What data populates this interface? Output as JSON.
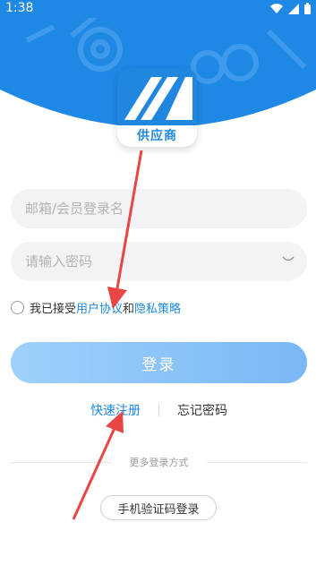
{
  "status_bar": {
    "time": "1:38"
  },
  "logo": {
    "caption": "供应商"
  },
  "login_form": {
    "account_placeholder": "邮箱/会员登录名",
    "password_placeholder": "请输入密码"
  },
  "agreement": {
    "prefix": "我已接受",
    "user_agreement": "用户协议",
    "conjunction": "和",
    "privacy_policy": "隐私策略"
  },
  "buttons": {
    "login": "登录",
    "quick_register": "快速注册",
    "forgot_password": "忘记密码",
    "sms_login": "手机验证码登录"
  },
  "more_login": "更多登录方式",
  "colors": {
    "brand": "#1e88e5",
    "button_start": "#9fd0fb",
    "button_end": "#7ab7f6",
    "annotation": "#e84545"
  }
}
